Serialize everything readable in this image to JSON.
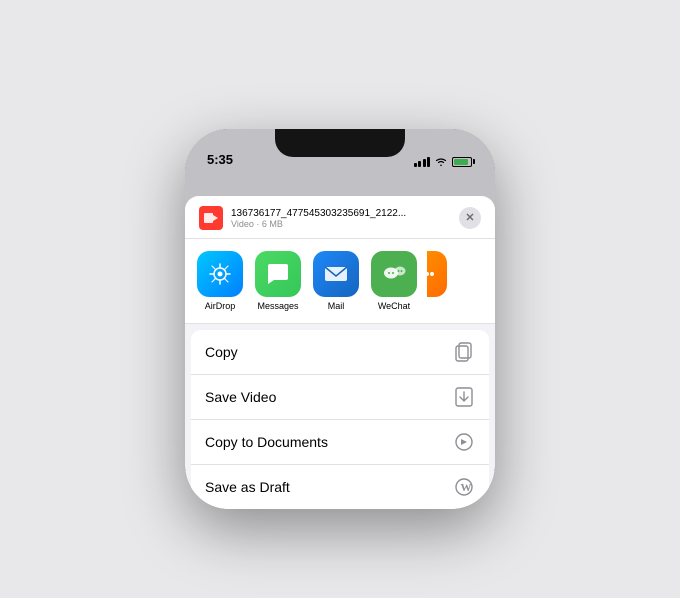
{
  "background": "#e8e8ea",
  "phone": {
    "status_bar": {
      "time": "5:35",
      "signal": true,
      "wifi": true,
      "battery": true
    },
    "share_header": {
      "file_name": "136736177_477545303235691_2122...",
      "file_meta": "Video · 6 MB",
      "close_label": "×"
    },
    "apps": [
      {
        "id": "airdrop",
        "label": "AirDrop",
        "type": "airdrop"
      },
      {
        "id": "messages",
        "label": "Messages",
        "type": "messages"
      },
      {
        "id": "mail",
        "label": "Mail",
        "type": "mail"
      },
      {
        "id": "wechat",
        "label": "WeChat",
        "type": "wechat"
      }
    ],
    "actions": [
      {
        "id": "copy",
        "label": "Copy",
        "icon": "copy"
      },
      {
        "id": "save-video",
        "label": "Save Video",
        "icon": "save"
      },
      {
        "id": "copy-to-documents",
        "label": "Copy to Documents",
        "icon": "documents"
      },
      {
        "id": "save-as-draft",
        "label": "Save as Draft",
        "icon": "draft"
      }
    ]
  }
}
